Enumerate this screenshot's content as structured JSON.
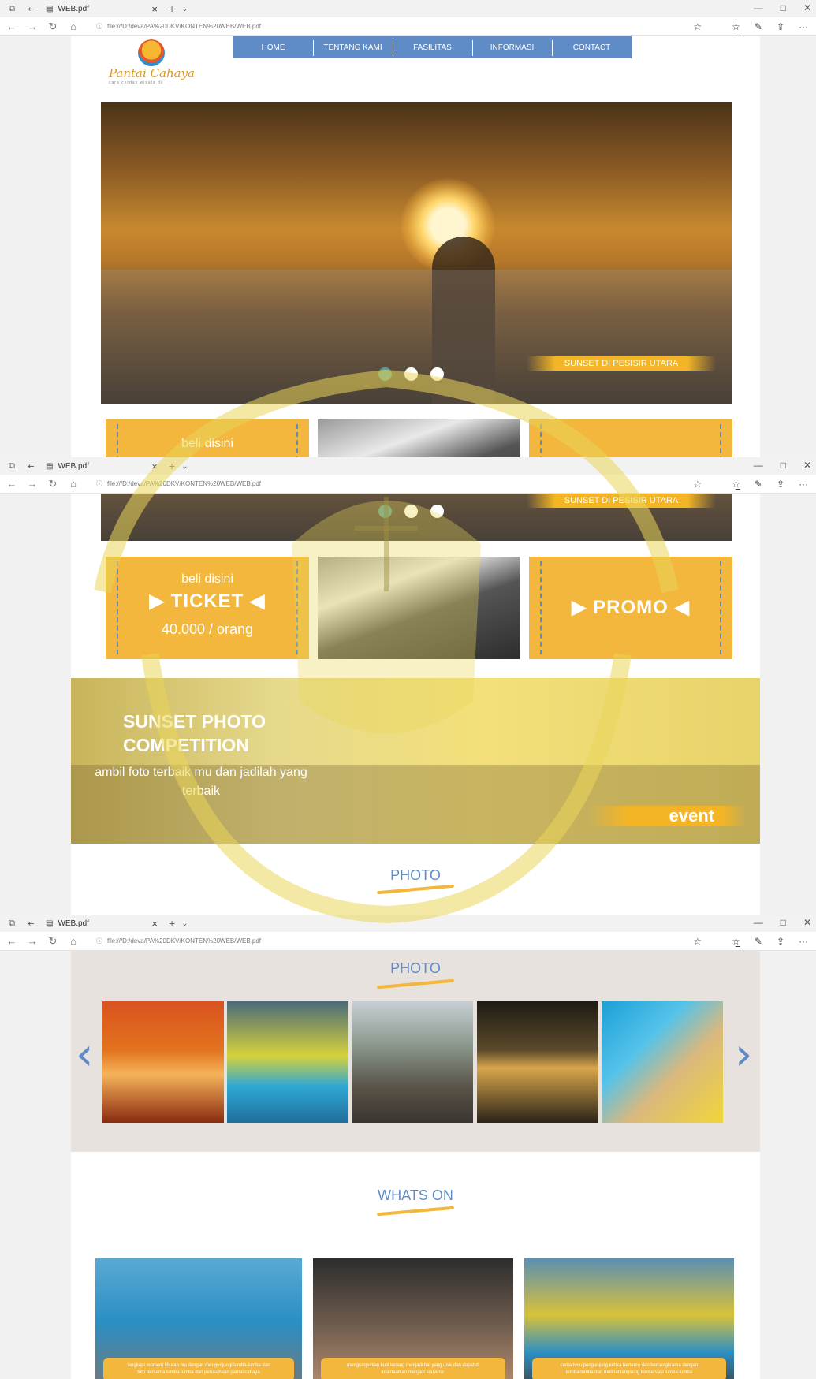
{
  "browser": {
    "tab_title": "WEB.pdf",
    "tab_close": "×",
    "new_tab": "+",
    "tab_menu": "⌄",
    "url": "file:///D:/deva/PA%20DKV/KONTEN%20WEB/WEB.pdf",
    "info_icon": "ⓘ",
    "favorite": "☆",
    "favorites": "☆̲",
    "notes": "✎",
    "share": "⇪",
    "more": "···",
    "minimize": "—",
    "maximize": "□",
    "close": "✕",
    "back": "←",
    "forward": "→",
    "refresh": "↻",
    "home": "⌂"
  },
  "site": {
    "logo_text": "Pantai Cahaya",
    "logo_tag": "cara cerdas wisata di",
    "nav": [
      "HOME",
      "TENTANG KAMI",
      "FASILITAS",
      "INFORMASI",
      "CONTACT"
    ]
  },
  "hero": {
    "caption": "SUNSET DI PESISIR UTARA",
    "slide_count": 3,
    "active_slide": 1
  },
  "ticket": {
    "small": "beli disini",
    "title": "▶ TICKET ◀",
    "price": "40.000 / orang"
  },
  "promo": {
    "title": "▶ PROMO ◀"
  },
  "event": {
    "title_line1": "SUNSET PHOTO",
    "title_line2": "COMPETITION",
    "sub": "ambil foto terbaik mu dan jadilah yang terbaik",
    "tag": "event"
  },
  "photo": {
    "title": "PHOTO",
    "prev": "‹",
    "next": "›"
  },
  "whatson": {
    "title": "WHATS ON",
    "cards": [
      "lengkapi moment liburan mu dengan mengunjungi lumba-lumba dan foto bersama lumba-lumba dari perusahaan pantai cahaya",
      "mengumpulkan kulit kerang menjadi hal yang unik dan dapat di manfaatkan menjadi souvenir",
      "cerita lucu pengunjung ketika bertemu dan bercengkrama dengan lumba-lumba dan melihat langsung konservasi lumba-lumba"
    ]
  },
  "colors": {
    "nav_blue": "#5f8cc6",
    "accent_yellow": "#f2b73c"
  }
}
